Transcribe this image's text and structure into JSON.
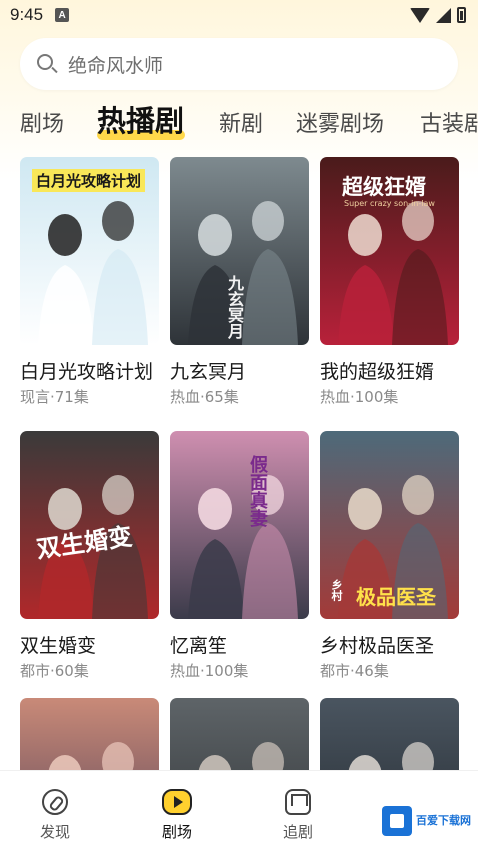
{
  "status_bar": {
    "time": "9:45",
    "badge": "A"
  },
  "search": {
    "placeholder": "绝命风水师"
  },
  "tabs": [
    {
      "label": "剧场"
    },
    {
      "label": "热播剧"
    },
    {
      "label": "新剧"
    },
    {
      "label": "迷雾剧场"
    },
    {
      "label": "古装剧"
    }
  ],
  "cards": [
    {
      "title": "白月光攻略计划",
      "meta": "现言·71集",
      "poster_text": "白月光攻略计划",
      "colors": [
        "#cfe8f2",
        "#ffffff",
        "#2b2b2b"
      ]
    },
    {
      "title": "九玄冥月",
      "meta": "热血·65集",
      "poster_text": "九玄冥月",
      "colors": [
        "#7e8a8f",
        "#2e3338",
        "#cfd6d8"
      ]
    },
    {
      "title": "我的超级狂婿",
      "meta": "热血·100集",
      "poster_text": "超级狂婿",
      "poster_sub": "Super crazy son-in-law",
      "colors": [
        "#4a1b1b",
        "#b8213a",
        "#e8d2c8"
      ]
    },
    {
      "title": "双生婚变",
      "meta": "都市·60集",
      "poster_text": "双生婚变",
      "colors": [
        "#3a3a3a",
        "#b0282a",
        "#d8d0c8"
      ]
    },
    {
      "title": "忆离笙",
      "meta": "热血·100集",
      "poster_text": "假面真妻",
      "colors": [
        "#cf8fb0",
        "#3b3b4a",
        "#f3d8e0"
      ]
    },
    {
      "title": "乡村极品医圣",
      "meta": "都市·46集",
      "poster_text": "极品医圣",
      "poster_prefix": "乡村",
      "colors": [
        "#4d6a7a",
        "#a33a38",
        "#e2d4c4"
      ]
    },
    {
      "title": "",
      "meta": "",
      "poster_text": "",
      "colors": [
        "#c98a78",
        "#4a3a52",
        "#e8c4b8"
      ]
    },
    {
      "title": "",
      "meta": "",
      "poster_text": "",
      "colors": [
        "#5e6468",
        "#2b2e30",
        "#c9c0b8"
      ]
    },
    {
      "title": "",
      "meta": "",
      "poster_text": "",
      "colors": [
        "#4a5560",
        "#1f2429",
        "#d7d2cc"
      ]
    }
  ],
  "bottom_nav": [
    {
      "label": "发现",
      "icon": "compass-icon"
    },
    {
      "label": "剧场",
      "icon": "play-icon"
    },
    {
      "label": "追剧",
      "icon": "crown-icon"
    }
  ],
  "watermark": {
    "line1": "百爱下载网"
  }
}
